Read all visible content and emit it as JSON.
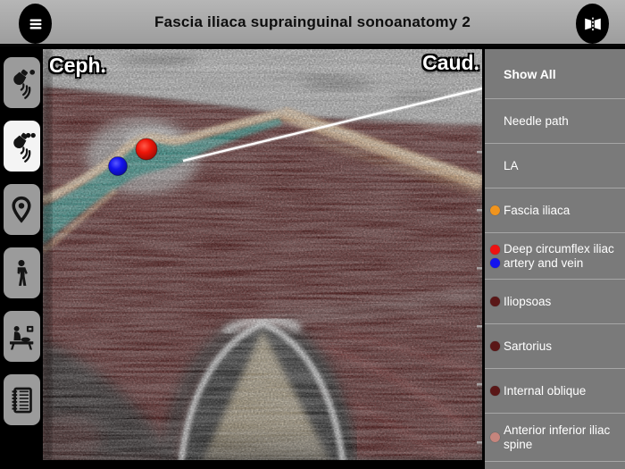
{
  "header": {
    "title": "Fascia iliaca suprainguinal sonoanatomy 2",
    "menu_button_icon": "hamburger-menu-icon",
    "flip_button_icon": "flip-horizontal-icon"
  },
  "left_toolbar": {
    "items": [
      {
        "icon": "ultrasound-probe-one-dot",
        "active": false
      },
      {
        "icon": "ultrasound-probe-two-dots",
        "active": true
      },
      {
        "icon": "location-pin",
        "active": false
      },
      {
        "icon": "human-body",
        "active": false
      },
      {
        "icon": "patient-exam-scene",
        "active": false
      },
      {
        "icon": "notebook",
        "active": false
      }
    ]
  },
  "ultrasound": {
    "label_cephalad": "Ceph.",
    "label_caudad": "Caud.",
    "overlay_colors": {
      "la_teal": "#2e9187",
      "fascia_tan": "#e3bd92",
      "muscle_maroon": "#571414",
      "artery_red": "#ee1609",
      "vein_blue": "#1414ee",
      "bone_tan": "#a39578",
      "needle_white": "#ffffff"
    }
  },
  "layers_menu": {
    "items": [
      {
        "label": "Show All",
        "dots": [],
        "emphasis": true
      },
      {
        "label": "Needle path",
        "dots": []
      },
      {
        "label": "LA",
        "dots": []
      },
      {
        "label": "Fascia iliaca",
        "dots": [
          "#f0941e"
        ]
      },
      {
        "label": "Deep circumflex iliac artery and vein",
        "dots": [
          "#ee1111",
          "#1313ee"
        ]
      },
      {
        "label": "Iliopsoas",
        "dots": [
          "#5a1717"
        ]
      },
      {
        "label": "Sartorius",
        "dots": [
          "#5a1717"
        ]
      },
      {
        "label": "Internal oblique",
        "dots": [
          "#5a1717"
        ]
      },
      {
        "label": "Anterior inferior iliac spine",
        "dots": [
          "#c5857d"
        ]
      }
    ]
  }
}
